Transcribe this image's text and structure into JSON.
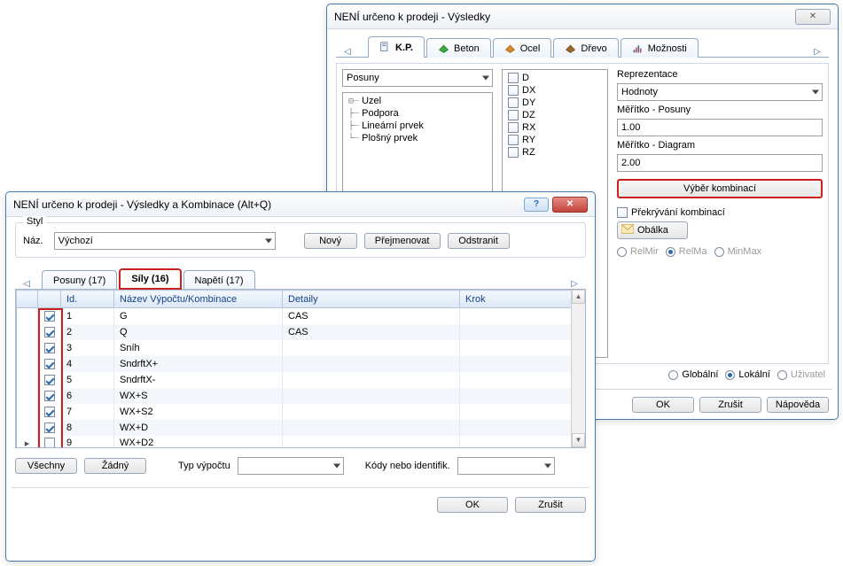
{
  "back": {
    "title": "NENÍ určeno k prodeji - Výsledky",
    "tabs": [
      "K.P.",
      "Beton",
      "Ocel",
      "Dřevo",
      "Možnosti"
    ],
    "active_tab": 0,
    "result_combo": "Posuny",
    "tree": [
      "Uzel",
      "Podpora",
      "Lineární prvek",
      "Plošný prvek"
    ],
    "dofs": [
      "D",
      "DX",
      "DY",
      "DZ",
      "RX",
      "RY",
      "RZ"
    ],
    "rep_label": "Reprezentace",
    "rep_value": "Hodnoty",
    "scale1_label": "Měřítko - Posuny",
    "scale1_value": "1.00",
    "scale2_label": "Měřítko - Diagram",
    "scale2_value": "2.00",
    "select_comb_btn": "Výběr kombinací",
    "overlap_label": "Překrývání kombinací",
    "envelope_btn": "Obálka",
    "env_opts": [
      "RelMir",
      "RelMa",
      "MinMax"
    ],
    "axes": {
      "global": "Globální",
      "local": "Lokální",
      "user": "Uživatel"
    },
    "footer": {
      "ok": "OK",
      "cancel": "Zrušit",
      "help": "Nápověda"
    }
  },
  "front": {
    "title": "NENÍ určeno k prodeji - Výsledky a Kombinace (Alt+Q)",
    "styl_legend": "Styl",
    "name_label": "Náz.",
    "name_value": "Výchozí",
    "new_btn": "Nový",
    "rename_btn": "Přejmenovat",
    "delete_btn": "Odstranit",
    "tabs": [
      "Posuny (17)",
      "Síly (16)",
      "Napětí (17)"
    ],
    "active_tab": 1,
    "cols": {
      "chk": "",
      "id": "Id.",
      "name": "Název Výpočtu/Kombinace",
      "det": "Detaily",
      "step": "Krok"
    },
    "rows": [
      {
        "chk": true,
        "id": "1",
        "name": "G",
        "det": "CAS",
        "step": ""
      },
      {
        "chk": true,
        "id": "2",
        "name": "Q",
        "det": "CAS",
        "step": ""
      },
      {
        "chk": true,
        "id": "3",
        "name": "Sníh",
        "det": "",
        "step": ""
      },
      {
        "chk": true,
        "id": "4",
        "name": "SndrftX+",
        "det": "",
        "step": ""
      },
      {
        "chk": true,
        "id": "5",
        "name": " SndrftX-",
        "det": "",
        "step": ""
      },
      {
        "chk": true,
        "id": "6",
        "name": "WX+S",
        "det": "",
        "step": ""
      },
      {
        "chk": true,
        "id": "7",
        "name": "WX+S2",
        "det": "",
        "step": ""
      },
      {
        "chk": true,
        "id": "8",
        "name": "WX+D",
        "det": "",
        "step": ""
      },
      {
        "chk": false,
        "id": "9",
        "name": "WX+D2",
        "det": "",
        "step": ""
      }
    ],
    "all_btn": "Všechny",
    "none_btn": "Žádný",
    "calc_type_label": "Typ výpočtu",
    "codes_label": "Kódy nebo identifik.",
    "ok": "OK",
    "cancel": "Zrušit"
  }
}
